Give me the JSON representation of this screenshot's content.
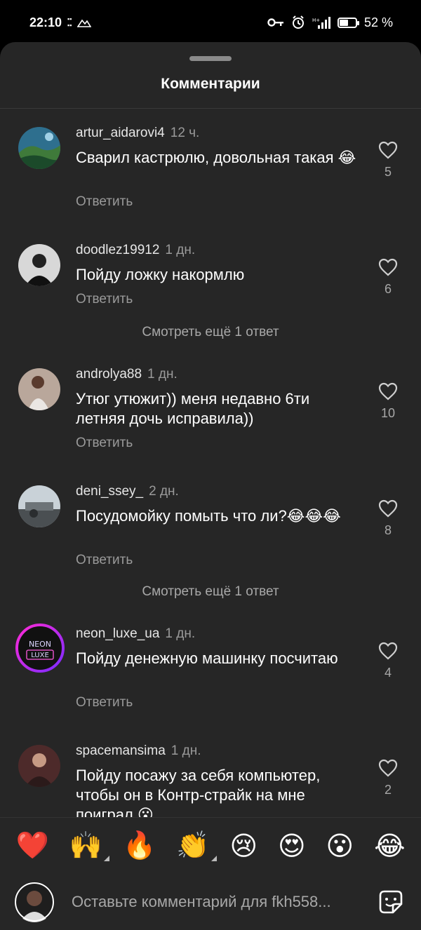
{
  "status_bar": {
    "time": "22:10",
    "battery": "52 %",
    "battery_level": 0.52
  },
  "sheet": {
    "title": "Комментарии"
  },
  "comments": [
    {
      "username": "artur_aidarovi4",
      "time": "12 ч.",
      "text": "Сварил кастрюлю, довольная такая 😂",
      "reply": "Ответить",
      "likes": "5"
    },
    {
      "username": "doodlez19912",
      "time": "1 дн.",
      "text": "Пойду ложку накормлю",
      "reply": "Ответить",
      "likes": "6",
      "more": "Смотреть ещё 1 ответ"
    },
    {
      "username": "androlya88",
      "time": "1 дн.",
      "text": "Утюг утюжит)) меня недавно 6ти летняя дочь исправила))",
      "reply": "Ответить",
      "likes": "10"
    },
    {
      "username": "deni_ssey_",
      "time": "2 дн.",
      "text": "Посудомойку помыть что ли?😂😂😂",
      "reply": "Ответить",
      "likes": "8",
      "more": "Смотреть ещё 1 ответ"
    },
    {
      "username": "neon_luxe_ua",
      "time": "1 дн.",
      "text": "Пойду денежную машинку посчитаю",
      "reply": "Ответить",
      "likes": "4",
      "avatar_text_1": "NEON",
      "avatar_text_2": "LUXE"
    },
    {
      "username": "spacemansima",
      "time": "1 дн.",
      "text": "Пойду посажу за себя компьютер, чтобы он в Контр-страйк на мне поиграл 😮",
      "reply": "Ответить",
      "likes": "2"
    }
  ],
  "emoji_bar": {
    "emojis": [
      "❤️",
      "🙌",
      "🔥",
      "👏",
      "😢",
      "😍",
      "😮",
      "😂"
    ]
  },
  "input": {
    "placeholder": "Оставьте комментарий для fkh558..."
  },
  "colors": {
    "background": "#000000",
    "sheet": "#262626",
    "secondary_text": "#9a9a9a",
    "heart_emoji": "#e0245e"
  }
}
